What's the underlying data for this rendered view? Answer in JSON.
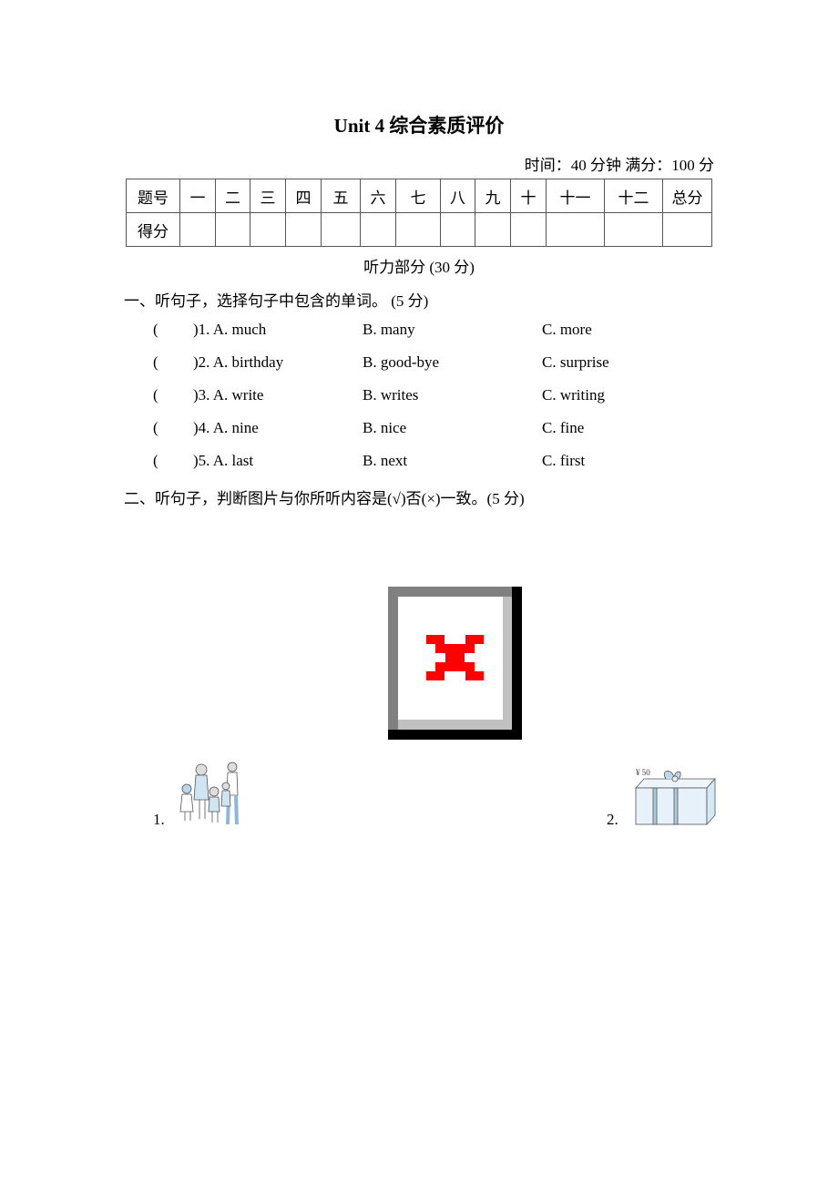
{
  "header": {
    "title": "Unit 4  综合素质评价",
    "meta": "时间：40 分钟    满分：100 分"
  },
  "score_table": {
    "header_row": [
      "题号",
      "一",
      "二",
      "三",
      "四",
      "五",
      "六",
      "七",
      "八",
      "九",
      "十",
      "十一",
      "十二",
      "总分"
    ],
    "score_row_label": "得分",
    "scores": [
      "",
      "",
      "",
      "",
      "",
      "",
      "",
      "",
      "",
      "",
      "",
      "",
      ""
    ]
  },
  "section": {
    "title": "听力部分  (30 分)"
  },
  "part1": {
    "title": "一、听句子，选择句子中包含的单词。  (5 分)",
    "questions": [
      {
        "paren": "(",
        "num_a": ")1. A. much",
        "b": "B. many",
        "c": "C. more"
      },
      {
        "paren": "(",
        "num_a": ")2. A. birthday",
        "b": "B. good-bye",
        "c": "C. surprise"
      },
      {
        "paren": "(",
        "num_a": ")3. A. write",
        "b": "B. writes",
        "c": "C. writing"
      },
      {
        "paren": "(",
        "num_a": ")4. A. nine",
        "b": "B. nice",
        "c": "C. fine"
      },
      {
        "paren": "(",
        "num_a": ")5. A. last",
        "b": "B. next",
        "c": "C. first"
      }
    ]
  },
  "part2": {
    "title": "二、听句子，判断图片与你所听内容是(√)否(×)一致。(5 分)",
    "broken_image_icon": "broken-image-icon",
    "pictures": [
      {
        "label": "1.",
        "description": "family-group-illustration"
      },
      {
        "label": "2.",
        "description": "gift-box-illustration",
        "price_tag": "¥ 50"
      }
    ]
  }
}
